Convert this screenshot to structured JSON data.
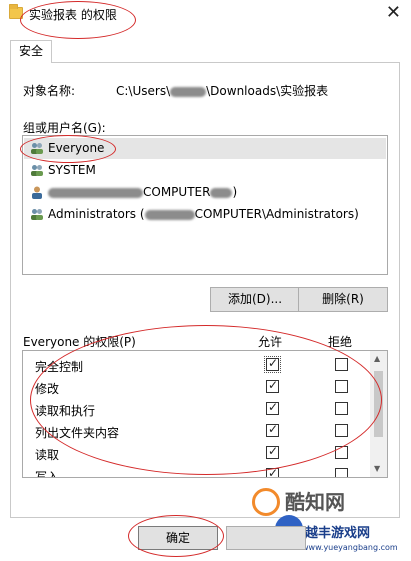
{
  "window": {
    "title": "实验报表 的权限",
    "close_glyph": "✕"
  },
  "tabs": [
    {
      "label": "安全"
    }
  ],
  "object": {
    "label": "对象名称:",
    "path_prefix": "C:\\Users\\",
    "path_suffix": "\\Downloads\\实验报表"
  },
  "groups": {
    "label": "组或用户名(G):",
    "items": [
      {
        "text": "Everyone",
        "selected": true,
        "icon": "users-icon"
      },
      {
        "text": "SYSTEM",
        "selected": false,
        "icon": "users-icon"
      },
      {
        "text_suffix": "COMPUTER",
        "text_end": ")",
        "selected": false,
        "icon": "user-icon"
      },
      {
        "text": "Administrators (",
        "text_suffix": "COMPUTER\\Administrators)",
        "selected": false,
        "icon": "users-icon"
      }
    ]
  },
  "buttons": {
    "add": "添加(D)...",
    "remove": "删除(R)"
  },
  "permissions": {
    "title": "Everyone 的权限(P)",
    "allow_header": "允许",
    "deny_header": "拒绝",
    "rows": [
      {
        "name": "完全控制",
        "allow": true,
        "deny": false
      },
      {
        "name": "修改",
        "allow": true,
        "deny": false
      },
      {
        "name": "读取和执行",
        "allow": true,
        "deny": false
      },
      {
        "name": "列出文件夹内容",
        "allow": true,
        "deny": false
      },
      {
        "name": "读取",
        "allow": true,
        "deny": false
      },
      {
        "name": "写入",
        "allow": true,
        "deny": false
      }
    ]
  },
  "footer": {
    "ok": "确定"
  },
  "watermark": {
    "brand1": "酷知网",
    "brand2": "越丰游戏网",
    "url": "www.yueyangbang.com"
  },
  "colors": {
    "annotation": "#d42a2a",
    "selection": "#e5e5e5",
    "button": "#e1e1e1"
  }
}
